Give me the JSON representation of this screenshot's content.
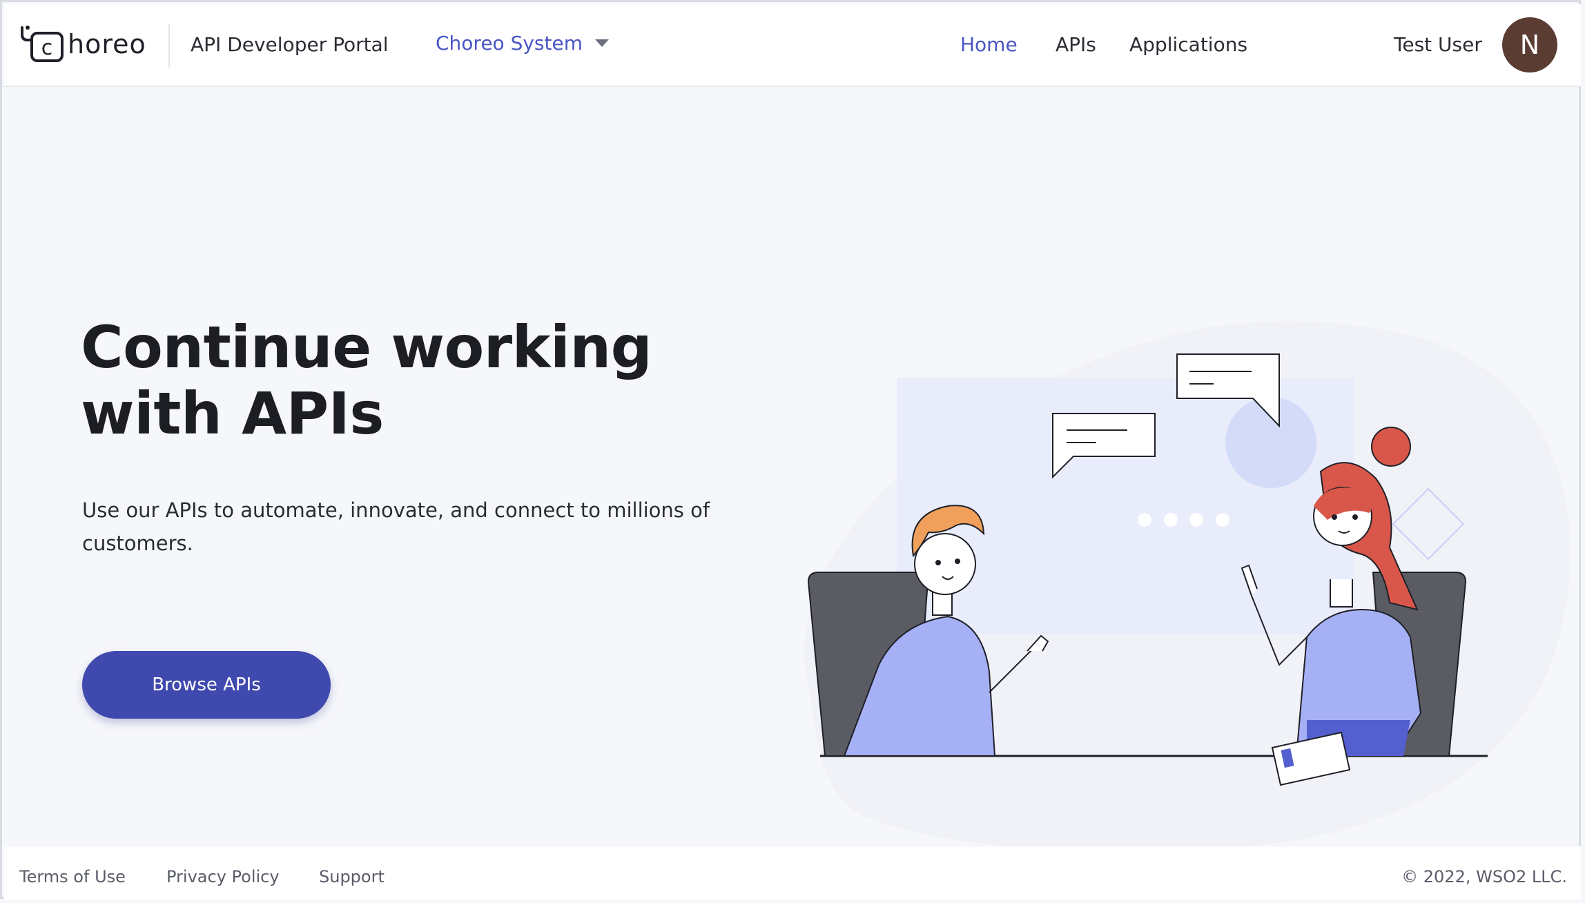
{
  "header": {
    "logo_text": "horeo",
    "logo_letter": "c",
    "portal_title": "API Developer Portal",
    "org_selector": "Choreo System",
    "nav": [
      "Home",
      "APIs",
      "Applications"
    ],
    "active_nav": "Home",
    "user_name": "Test User",
    "avatar_initial": "N"
  },
  "hero": {
    "title": "Continue working with APIs",
    "subtitle": "Use our APIs to automate, innovate, and connect to millions of customers.",
    "cta_label": "Browse APIs"
  },
  "footer": {
    "links": [
      "Terms of Use",
      "Privacy Policy",
      "Support"
    ],
    "copyright": "©  2022, WSO2 LLC."
  },
  "colors": {
    "accent": "#4a55c4",
    "button": "#4049ad",
    "avatar": "#5a3c33",
    "background": "#f6f7fb"
  }
}
